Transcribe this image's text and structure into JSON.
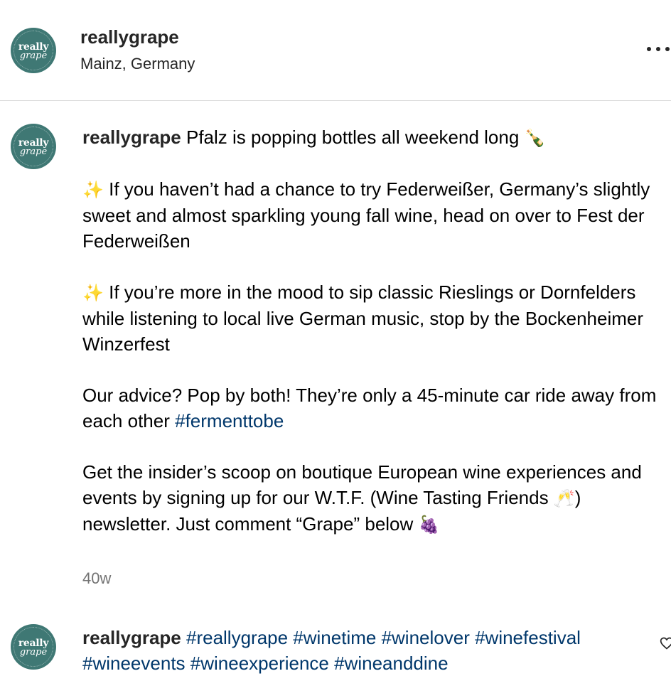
{
  "header": {
    "avatar_line1": "really",
    "avatar_line2": "grape",
    "username": "reallygrape",
    "location": "Mainz, Germany"
  },
  "caption": {
    "username": "reallygrape",
    "line1": "Pfalz is popping bottles all weekend long",
    "emoji_bottle": "🍾",
    "sparkle": "✨",
    "para1": "If you haven’t had a chance to try Federweißer, Germany’s slightly sweet and almost sparkling young fall wine, head on over to Fest der Federweißen",
    "para2": "If you’re more in the mood to sip classic Rieslings or Dornfelders while listening to local live German music, stop by the Bockenheimer Winzerfest",
    "para3_text": "Our advice? Pop by both! They’re only a 45-minute car ride away from each other",
    "para3_hashtag": "#fermenttobe",
    "para4_before": "Get the insider’s scoop on boutique European wine experiences and events by signing up for our W.T.F. (Wine Tasting Friends",
    "emoji_clink": "🥂",
    "para4_after": ") newsletter. Just comment “Grape” below",
    "emoji_grapes": "🍇",
    "timestamp": "40w"
  },
  "comment2": {
    "username": "reallygrape",
    "hashtags": "#reallygrape #winetime #winelover #winefestival #wineevents #wineexperience #wineanddine"
  },
  "colors": {
    "avatar_bg": "#3f7874",
    "hashtag": "#00376b",
    "timestamp": "#737373",
    "divider": "#dbdbdb"
  },
  "icons": [
    "more-options-icon",
    "heart-icon"
  ]
}
